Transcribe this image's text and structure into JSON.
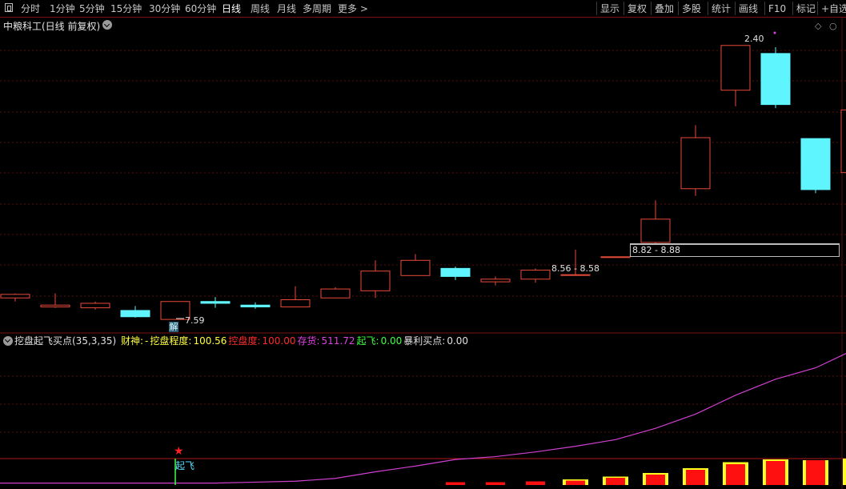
{
  "toolbar": {
    "periods": [
      "分时",
      "1分钟",
      "5分钟",
      "15分钟",
      "30分钟",
      "60分钟",
      "日线",
      "周线",
      "月线",
      "多周期",
      "更多 >"
    ],
    "active_period": "日线",
    "right_buttons": [
      "显示",
      "复权",
      "叠加",
      "多股",
      "统计",
      "画线",
      "F10",
      "标记",
      "+自选"
    ]
  },
  "chart_title": "中粮科工(日线 前复权)",
  "labels": {
    "high_price": "2.40",
    "low_price": "7.59",
    "range1": "8.82 - 8.88",
    "range2": "8.56 - 8.58",
    "jie_badge": "解",
    "qifei_marker": "起飞",
    "star_marker": "★"
  },
  "indicator": {
    "name": "挖盘起飞买点(35,3,35)",
    "items": [
      {
        "label": "财神:",
        "value": "-",
        "color": "#ffff40"
      },
      {
        "label": "挖盘程度:",
        "value": "100.56",
        "color": "#ffff40"
      },
      {
        "label": "控盘度:",
        "value": "100.00",
        "color": "#ff2a2a"
      },
      {
        "label": "存货:",
        "value": "511.72",
        "color": "#e040e0"
      },
      {
        "label": "起飞:",
        "value": "0.00",
        "color": "#40ff40"
      },
      {
        "label": "暴利买点:",
        "value": "0.00",
        "color": "#e0e0e0"
      }
    ]
  },
  "colors": {
    "up": "#e84a3a",
    "down": "#5ff5ff",
    "grid": "#5a0d0d",
    "line_magenta": "#d040d0",
    "bar_red": "#ff1010",
    "bar_yellow": "#ffff20"
  },
  "chart_data": {
    "type": "candlestick",
    "candles": [
      {
        "o": 7.78,
        "c": 7.82,
        "h": 7.83,
        "l": 7.74
      },
      {
        "o": 7.68,
        "c": 7.7,
        "h": 7.83,
        "l": 7.67
      },
      {
        "o": 7.67,
        "c": 7.72,
        "h": 7.74,
        "l": 7.65
      },
      {
        "o": 7.64,
        "c": 7.57,
        "h": 7.69,
        "l": 7.56
      },
      {
        "o": 7.54,
        "c": 7.74,
        "h": 7.74,
        "l": 7.54
      },
      {
        "o": 7.74,
        "c": 7.72,
        "h": 7.79,
        "l": 7.67
      },
      {
        "o": 7.7,
        "c": 7.68,
        "h": 7.73,
        "l": 7.66
      },
      {
        "o": 7.68,
        "c": 7.76,
        "h": 7.91,
        "l": 7.68
      },
      {
        "o": 7.78,
        "c": 7.88,
        "h": 7.9,
        "l": 7.78
      },
      {
        "o": 7.86,
        "c": 8.08,
        "h": 8.2,
        "l": 7.78
      },
      {
        "o": 8.03,
        "c": 8.2,
        "h": 8.27,
        "l": 8.03
      },
      {
        "o": 8.11,
        "c": 8.02,
        "h": 8.13,
        "l": 7.98
      },
      {
        "o": 7.96,
        "c": 7.99,
        "h": 8.02,
        "l": 7.92
      },
      {
        "o": 7.99,
        "c": 8.09,
        "h": 8.11,
        "l": 7.95
      },
      {
        "o": 8.04,
        "c": 8.04,
        "h": 8.32,
        "l": 8.04
      },
      {
        "o": 8.24,
        "c": 8.24,
        "h": 8.24,
        "l": 8.24
      },
      {
        "o": 8.4,
        "c": 8.66,
        "h": 8.87,
        "l": 8.36
      },
      {
        "o": 9.0,
        "c": 9.57,
        "h": 9.71,
        "l": 8.92
      },
      {
        "o": 10.1,
        "c": 10.6,
        "h": 10.6,
        "l": 9.92
      },
      {
        "o": 10.51,
        "c": 9.94,
        "h": 10.58,
        "l": 9.9
      },
      {
        "o": 9.56,
        "c": 8.99,
        "h": 9.56,
        "l": 8.95
      },
      {
        "o": 9.18,
        "c": 9.88,
        "h": 9.88,
        "l": 9.18
      }
    ],
    "indicator_line": [
      0.02,
      0.02,
      0.02,
      0.02,
      0.02,
      0.02,
      0.03,
      0.04,
      0.07,
      0.14,
      0.2,
      0.27,
      0.3,
      0.35,
      0.41,
      0.48,
      0.6,
      0.75,
      0.95,
      1.12,
      1.24,
      1.44
    ],
    "indicator_bars": [
      {
        "i": 11,
        "red": 0.07,
        "yellow": 0.0
      },
      {
        "i": 12,
        "red": 0.07,
        "yellow": 0.0
      },
      {
        "i": 13,
        "red": 0.09,
        "yellow": 0.0
      },
      {
        "i": 14,
        "red": 0.11,
        "yellow": 0.14
      },
      {
        "i": 15,
        "red": 0.18,
        "yellow": 0.21
      },
      {
        "i": 16,
        "red": 0.26,
        "yellow": 0.3
      },
      {
        "i": 17,
        "red": 0.38,
        "yellow": 0.42
      },
      {
        "i": 18,
        "red": 0.52,
        "yellow": 0.57
      },
      {
        "i": 19,
        "red": 0.6,
        "yellow": 0.64
      },
      {
        "i": 20,
        "red": 0.62,
        "yellow": 0.62
      },
      {
        "i": 21,
        "red": 0.66,
        "yellow": 0.66
      }
    ]
  }
}
